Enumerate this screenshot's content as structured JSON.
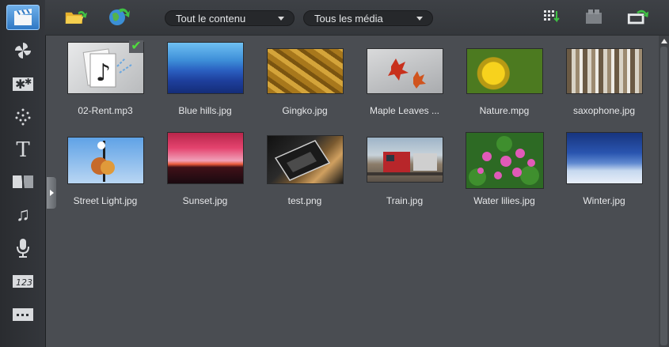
{
  "toolbar": {
    "content_filter": "Tout le contenu",
    "media_filter": "Tous les média"
  },
  "rail": {
    "items": [
      "media-library",
      "transitions",
      "effects",
      "particles",
      "title",
      "filters",
      "audio",
      "voice",
      "chapters",
      "subtitles"
    ]
  },
  "media": {
    "items": [
      {
        "name": "02-Rent.mp3",
        "kind": "audio",
        "checked": true
      },
      {
        "name": "Blue hills.jpg",
        "kind": "image"
      },
      {
        "name": "Gingko.jpg",
        "kind": "image"
      },
      {
        "name": "Maple Leaves ...",
        "kind": "image"
      },
      {
        "name": "Nature.mpg",
        "kind": "video"
      },
      {
        "name": "saxophone.jpg",
        "kind": "image"
      },
      {
        "name": "Street Light.jpg",
        "kind": "image"
      },
      {
        "name": "Sunset.jpg",
        "kind": "image"
      },
      {
        "name": "test.png",
        "kind": "image"
      },
      {
        "name": "Train.jpg",
        "kind": "image"
      },
      {
        "name": "Water lilies.jpg",
        "kind": "image"
      },
      {
        "name": "Winter.jpg",
        "kind": "image"
      }
    ]
  },
  "colors": {
    "background": "#4a4d52",
    "accent": "#2f78c4",
    "check": "#4fdc3c"
  }
}
